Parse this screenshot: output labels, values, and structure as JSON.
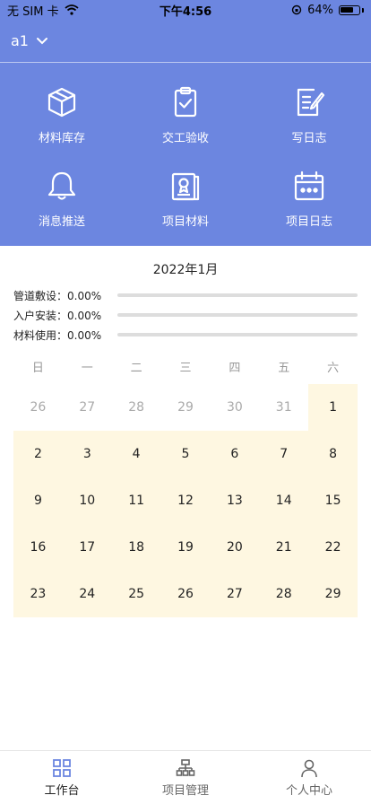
{
  "status_bar": {
    "carrier": "无 SIM 卡",
    "time": "下午4:56",
    "battery": "64%"
  },
  "project": {
    "name": "a1"
  },
  "grid": [
    {
      "label": "材料库存",
      "icon": "cube-icon"
    },
    {
      "label": "交工验收",
      "icon": "clipboard-check-icon"
    },
    {
      "label": "写日志",
      "icon": "edit-note-icon"
    },
    {
      "label": "消息推送",
      "icon": "bell-icon"
    },
    {
      "label": "项目材料",
      "icon": "certificate-icon"
    },
    {
      "label": "项目日志",
      "icon": "calendar-icon"
    }
  ],
  "month_title": "2022年1月",
  "stats": [
    {
      "label": "管道敷设：",
      "value": "0.00%",
      "progress": 0
    },
    {
      "label": "入户安装：",
      "value": "0.00%",
      "progress": 0
    },
    {
      "label": "材料使用：",
      "value": "0.00%",
      "progress": 0
    }
  ],
  "weekdays": [
    "日",
    "一",
    "二",
    "三",
    "四",
    "五",
    "六"
  ],
  "days": [
    {
      "d": "26",
      "muted": true
    },
    {
      "d": "27",
      "muted": true
    },
    {
      "d": "28",
      "muted": true
    },
    {
      "d": "29",
      "muted": true
    },
    {
      "d": "30",
      "muted": true
    },
    {
      "d": "31",
      "muted": true
    },
    {
      "d": "1",
      "muted": false
    },
    {
      "d": "2",
      "muted": false
    },
    {
      "d": "3",
      "muted": false
    },
    {
      "d": "4",
      "muted": false
    },
    {
      "d": "5",
      "muted": false
    },
    {
      "d": "6",
      "muted": false
    },
    {
      "d": "7",
      "muted": false
    },
    {
      "d": "8",
      "muted": false
    },
    {
      "d": "9",
      "muted": false
    },
    {
      "d": "10",
      "muted": false
    },
    {
      "d": "11",
      "muted": false
    },
    {
      "d": "12",
      "muted": false
    },
    {
      "d": "13",
      "muted": false
    },
    {
      "d": "14",
      "muted": false
    },
    {
      "d": "15",
      "muted": false
    },
    {
      "d": "16",
      "muted": false
    },
    {
      "d": "17",
      "muted": false
    },
    {
      "d": "18",
      "muted": false
    },
    {
      "d": "19",
      "muted": false
    },
    {
      "d": "20",
      "muted": false
    },
    {
      "d": "21",
      "muted": false
    },
    {
      "d": "22",
      "muted": false
    },
    {
      "d": "23",
      "muted": false
    },
    {
      "d": "24",
      "muted": false
    },
    {
      "d": "25",
      "muted": false
    },
    {
      "d": "26",
      "muted": false
    },
    {
      "d": "27",
      "muted": false
    },
    {
      "d": "28",
      "muted": false
    },
    {
      "d": "29",
      "muted": false
    }
  ],
  "tabs": [
    {
      "label": "工作台",
      "icon": "grid-icon",
      "active": true
    },
    {
      "label": "项目管理",
      "icon": "org-chart-icon",
      "active": false
    },
    {
      "label": "个人中心",
      "icon": "person-icon",
      "active": false
    }
  ],
  "colors": {
    "primary": "#6c86e0",
    "highlight": "#fef7e1"
  }
}
